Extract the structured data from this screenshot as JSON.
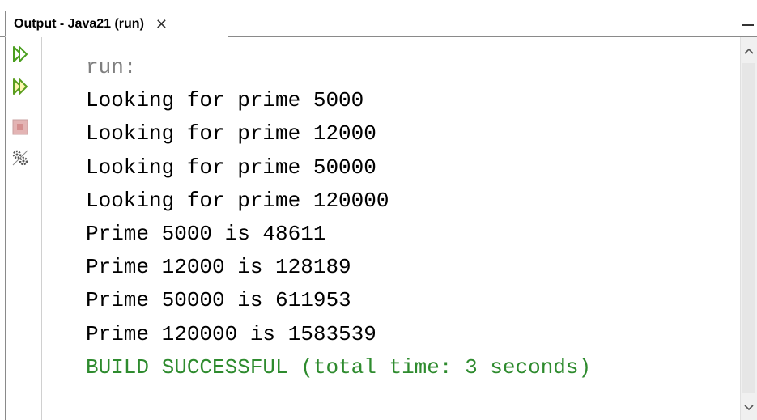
{
  "tab": {
    "title": "Output - Java21 (run)",
    "close_glyph": "✕"
  },
  "toolbar": {
    "items": [
      {
        "icon": "rerun-icon"
      },
      {
        "icon": "rerun-with-params-icon"
      },
      {
        "icon": "stop-icon"
      },
      {
        "icon": "settings-icon"
      }
    ]
  },
  "output": {
    "lines": [
      "run:",
      "Looking for prime 5000",
      "Looking for prime 12000",
      "Looking for prime 50000",
      "Looking for prime 120000",
      "Prime 5000 is 48611",
      "Prime 12000 is 128189",
      "Prime 50000 is 611953",
      "Prime 120000 is 1583539",
      "BUILD SUCCESSFUL (total time: 3 seconds)"
    ]
  },
  "colors": {
    "run_text": "#7f7f7f",
    "output_text": "#000000",
    "success_text": "#2e8b2e",
    "rerun_icon": "#6dbf3a"
  }
}
